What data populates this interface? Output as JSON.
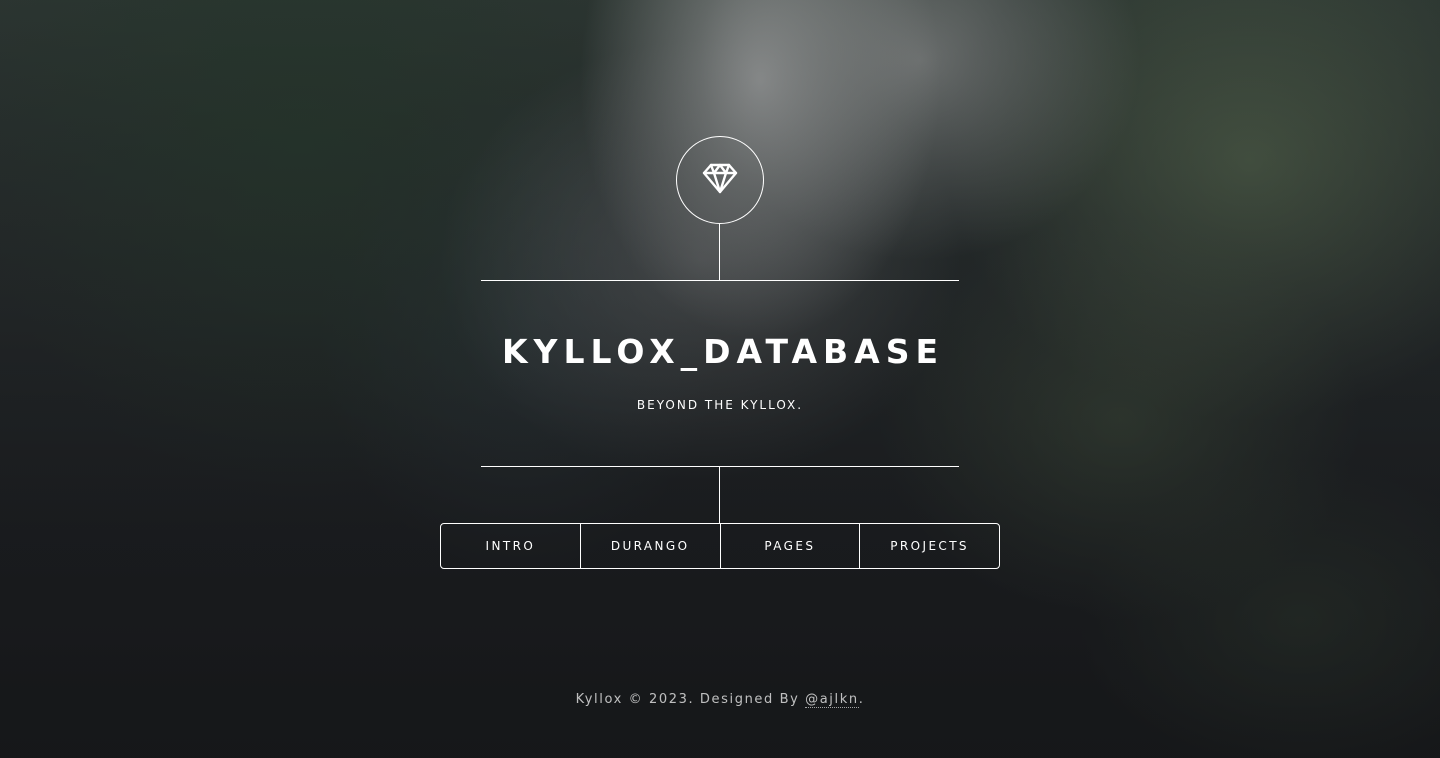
{
  "header": {
    "logo_icon": "diamond-icon",
    "title": "KYLLOX_DATABASE",
    "subtitle": "BEYOND THE KYLLOX."
  },
  "nav": {
    "items": [
      {
        "label": "INTRO"
      },
      {
        "label": "DURANGO"
      },
      {
        "label": "PAGES"
      },
      {
        "label": "PROJECTS"
      }
    ]
  },
  "footer": {
    "copyright": "Kyllox © 2023. Designed By ",
    "designer_link": "@ajlkn",
    "trailing": "."
  },
  "colors": {
    "foreground": "#ffffff",
    "background": "#1b1d20"
  }
}
